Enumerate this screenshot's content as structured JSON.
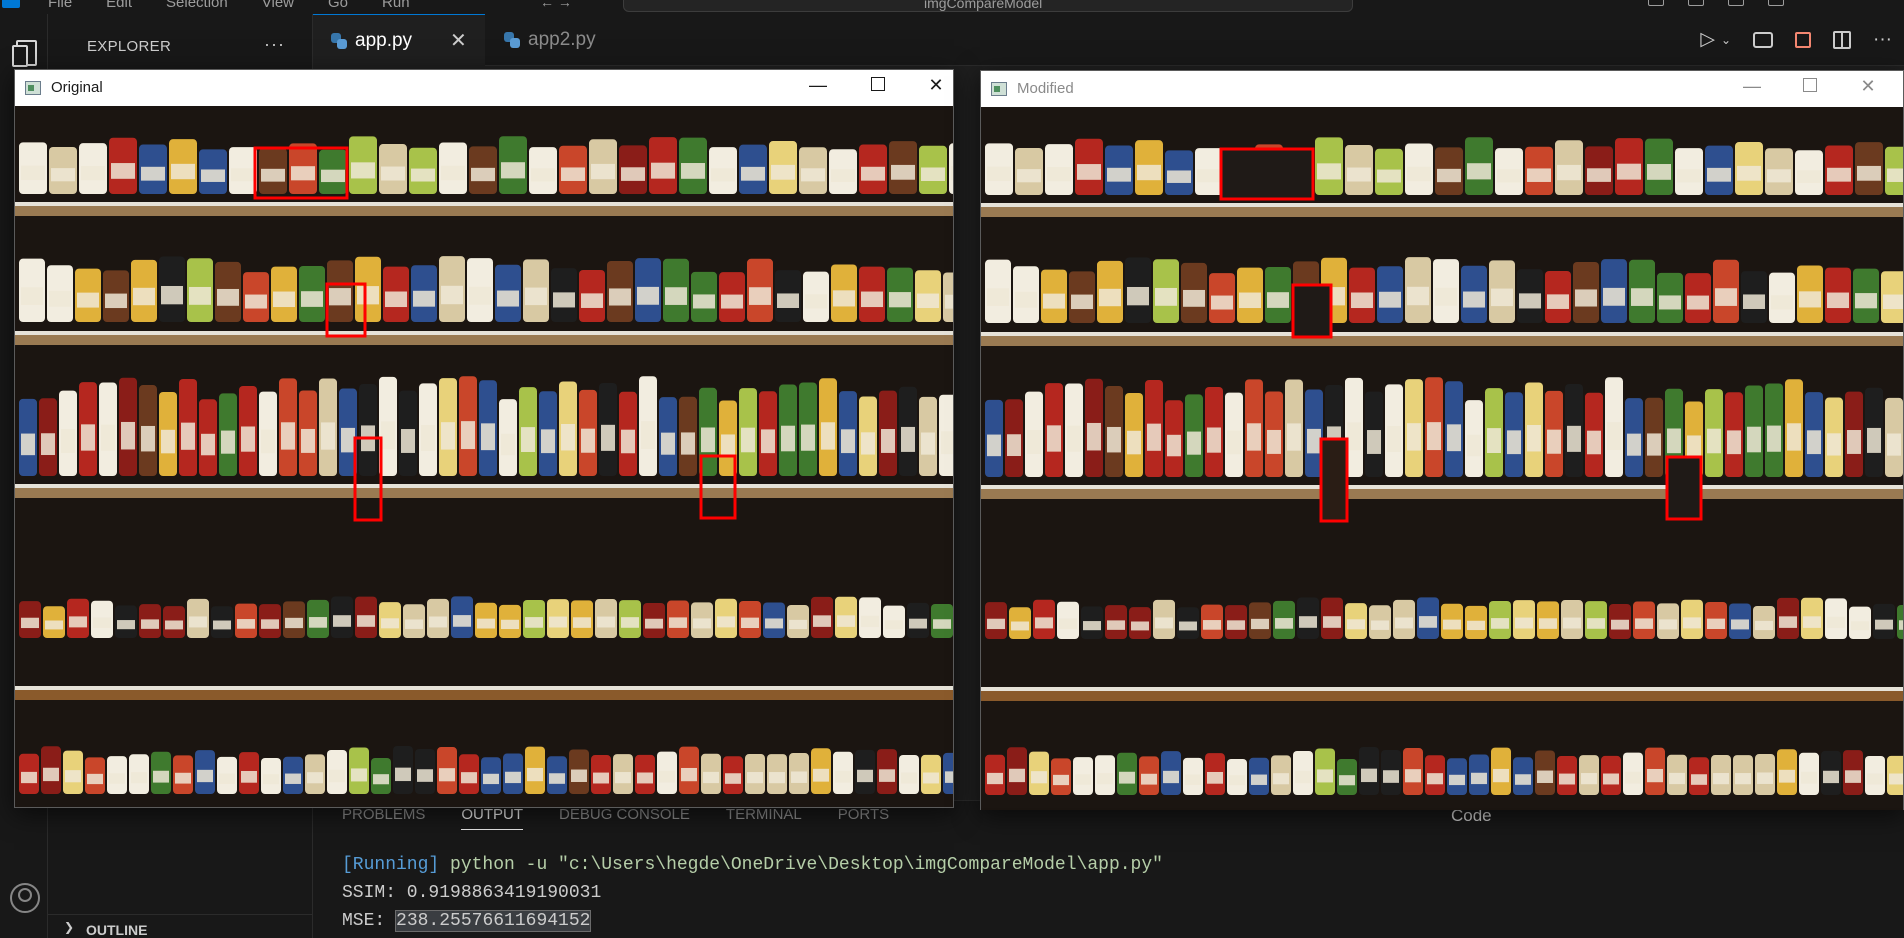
{
  "menu": [
    "File",
    "Edit",
    "Selection",
    "View",
    "Go",
    "Run"
  ],
  "command_center": "imgCompareModel",
  "explorer": {
    "title": "EXPLORER",
    "more": "···",
    "outline": "OUTLINE"
  },
  "tabs": [
    {
      "label": "app.py",
      "active": true
    },
    {
      "label": "app2.py",
      "active": false
    }
  ],
  "panel": {
    "tabs": [
      "PROBLEMS",
      "OUTPUT",
      "DEBUG CONSOLE",
      "TERMINAL",
      "PORTS"
    ],
    "active_tab": "OUTPUT",
    "channel": "Code",
    "output": {
      "running_tag": "[Running]",
      "command": "python -u \"c:\\Users\\hegde\\OneDrive\\Desktop\\imgCompareModel\\app.py\"",
      "ssim_line": "SSIM: 0.9198863419190031",
      "mse_label": "MSE:",
      "mse_value": "238.25576611694152"
    }
  },
  "windows": {
    "original": {
      "title": "Original"
    },
    "modified": {
      "title": "Modified"
    }
  },
  "window_controls": {
    "minimize": "—",
    "close": "✕"
  },
  "colors": {
    "accent": "#0078d4",
    "highlight": "#ff0000",
    "background": "#1f1f1f"
  }
}
